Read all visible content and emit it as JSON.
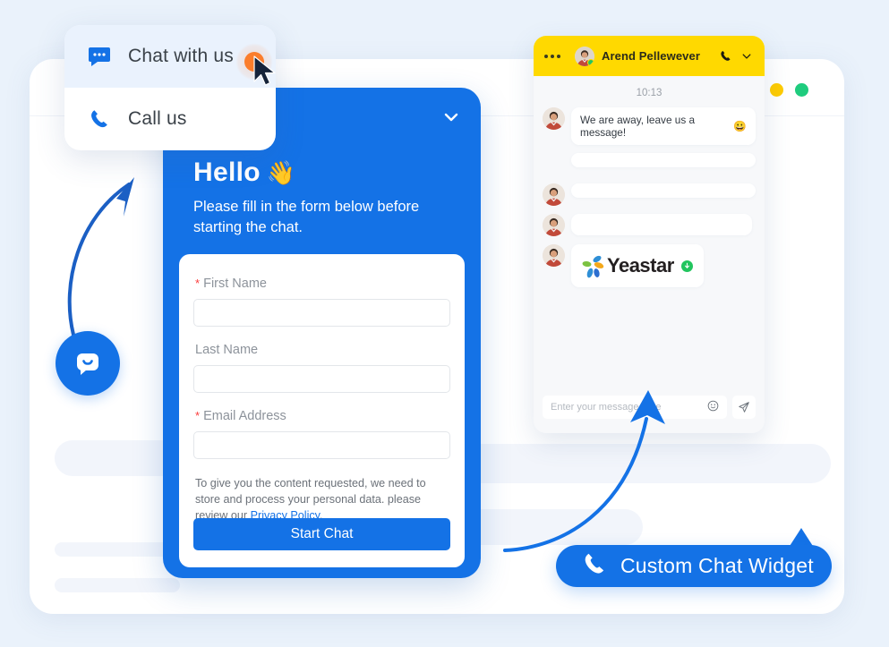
{
  "background": {
    "accent_color": "#1472e6",
    "page_background": "#eaf2fb",
    "window_dots": [
      "#f4462c",
      "#ffcc00",
      "#1fcc7e"
    ]
  },
  "menu": {
    "items": [
      {
        "label": "Chat with us",
        "icon": "chat-bubble-icon",
        "active": true
      },
      {
        "label": "Call us",
        "icon": "phone-icon",
        "active": false
      }
    ]
  },
  "launcher": {
    "icon": "chat-smile-icon"
  },
  "widget": {
    "collapse_icon": "chevron-down-icon",
    "greeting": "Hello",
    "greeting_emoji": "👋",
    "subtitle": "Please fill in the form below before starting the chat.",
    "form": {
      "fields": [
        {
          "label": "First Name",
          "required": true,
          "value": "",
          "placeholder": ""
        },
        {
          "label": "Last Name",
          "required": false,
          "value": "",
          "placeholder": ""
        },
        {
          "label": "Email Address",
          "required": true,
          "value": "",
          "placeholder": ""
        }
      ],
      "consent_text": "To give you the content requested, we need to store and process your personal data. please review our ",
      "consent_link": "Privacy Policy",
      "consent_tail": ".",
      "submit_label": "Start Chat"
    }
  },
  "chat": {
    "header": {
      "menu_icon": "more-horizontal-icon",
      "agent_name": "Arend Pellewever",
      "call_icon": "phone-icon",
      "collapse_icon": "chevron-down-icon",
      "status": "online"
    },
    "timestamp": "10:13",
    "messages": [
      {
        "type": "text",
        "text": "We are away, leave us a message!",
        "emoji": "😀",
        "avatar": true
      },
      {
        "type": "placeholder",
        "avatar": false,
        "lines": 2
      },
      {
        "type": "placeholder",
        "avatar": true,
        "lines": 2
      },
      {
        "type": "placeholder",
        "avatar": true,
        "lines": 1
      },
      {
        "type": "logo",
        "avatar": true,
        "logo_text": "Yeastar",
        "download_icon": "download-icon"
      }
    ],
    "input": {
      "placeholder": "Enter your message here",
      "emoji_icon": "smiley-icon",
      "send_icon": "send-icon"
    }
  },
  "badge": {
    "icon": "phone-icon",
    "label": "Custom Chat Widget"
  },
  "cursor": {
    "icon": "mouse-pointer-icon"
  }
}
